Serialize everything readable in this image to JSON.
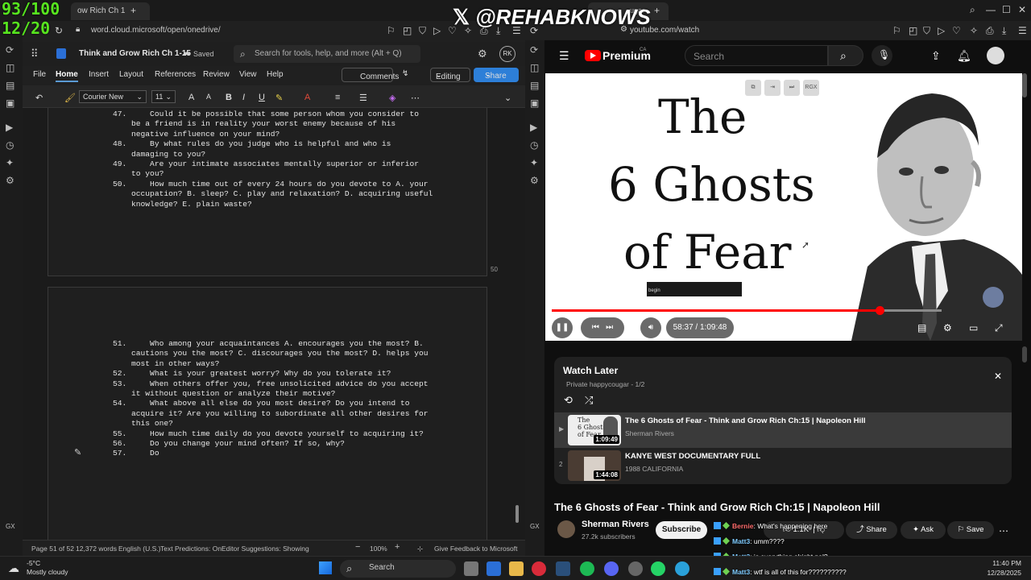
{
  "overlay": {
    "counter_top": "93/100",
    "counter_bottom": "12/20",
    "watermark": "@REHABKNOWS"
  },
  "left_browser": {
    "tab_title": "Think and Grow Rich Ch 1-15",
    "tab_visible": "ow Rich Ch 1",
    "url": "word.cloud.microsoft/open/onedrive/",
    "word": {
      "doc_title": "Think and Grow Rich Ch 1-15",
      "saved": "Saved",
      "search_placeholder": "Search for tools, help, and more (Alt + Q)",
      "avatar": "RK",
      "menu": [
        "File",
        "Home",
        "Insert",
        "Layout",
        "References",
        "Review",
        "View",
        "Help"
      ],
      "comments": "Comments",
      "editing": "Editing",
      "share": "Share",
      "font": "Courier New",
      "size": "11",
      "page1_lines": [
        "47.     Could it be possible that some person whom you consider to",
        "    be a friend is in reality your worst enemy because of his",
        "    negative influence on your mind?",
        "48.     By what rules do you judge who is helpful and who is",
        "    damaging to you?",
        "49.     Are your intimate associates mentally superior or inferior",
        "    to you?",
        "50.     How much time out of every 24 hours do you devote to A. your",
        "    occupation? B. sleep? C. play and relaxation? D. acquiring useful",
        "    knowledge? E. plain waste?"
      ],
      "page2_lines": [
        "51.     Who among your acquaintances A. encourages you the most? B.",
        "    cautions you the most? C. discourages you the most? D. helps you",
        "    most in other ways?",
        "52.     What is your greatest worry? Why do you tolerate it?",
        "53.     When others offer you, free unsolicited advice do you accept",
        "    it without question or analyze their motive?",
        "54.     What above all else do you most desire? Do you intend to",
        "    acquire it? Are you willing to subordinate all other desires for",
        "    this one?",
        "55.     How much time daily do you devote yourself to acquiring it?",
        "56.     Do you change your mind often? If so, why?",
        "57.     Do"
      ],
      "page_number": "50",
      "status": {
        "page": "Page 51 of 52",
        "words": "12,372 words",
        "lang": "English (U.S.)",
        "predictions": "Text Predictions: On",
        "editor": "Editor Suggestions: Showing",
        "zoom": "100%",
        "feedback": "Give Feedback to Microsoft"
      }
    }
  },
  "right_browser": {
    "url": "youtube.com/watch",
    "tab_label": "ugar",
    "premium": "Premium",
    "region": "CA",
    "search_placeholder": "Search",
    "video": {
      "line1": "The",
      "line2": "6 Ghosts",
      "line3": "of Fear",
      "time": "58:37 / 1:09:48",
      "progress": 0.84,
      "caption": "begin"
    },
    "watch_later": {
      "title": "Watch Later",
      "subtitle": "Private happycougar - 1/2",
      "items": [
        {
          "title": "The 6 Ghosts of Fear - Think and Grow Rich Ch:15 | Napoleon Hill",
          "channel": "Sherman Rivers",
          "duration": "1:09:49"
        },
        {
          "title": "KANYE WEST DOCUMENTARY FULL",
          "channel": "1988 CALIFORNIA",
          "duration": "1:44:08",
          "index": "2"
        }
      ]
    },
    "video_title": "The 6 Ghosts of Fear - Think and Grow Rich Ch:15 | Napoleon Hill",
    "channel": "Sherman Rivers",
    "subscribers": "27.2k subscribers",
    "subscribe": "Subscribe",
    "likes": "1.1K",
    "share": "Share",
    "ask": "Ask",
    "save": "Save",
    "chat": [
      {
        "user": "Bernie",
        "msg": ": What's happening here"
      },
      {
        "user": "Matt3",
        "msg": ": umm????"
      },
      {
        "user": "Matt3",
        "msg": ": is everything alright pal?"
      },
      {
        "user": "Matt3",
        "msg": ": wtf is all of this for??????????"
      }
    ]
  },
  "taskbar": {
    "temp": "-5°C",
    "weather": "Mostly cloudy",
    "search": "Search",
    "time": "11:40 PM",
    "date": "12/28/2025"
  }
}
